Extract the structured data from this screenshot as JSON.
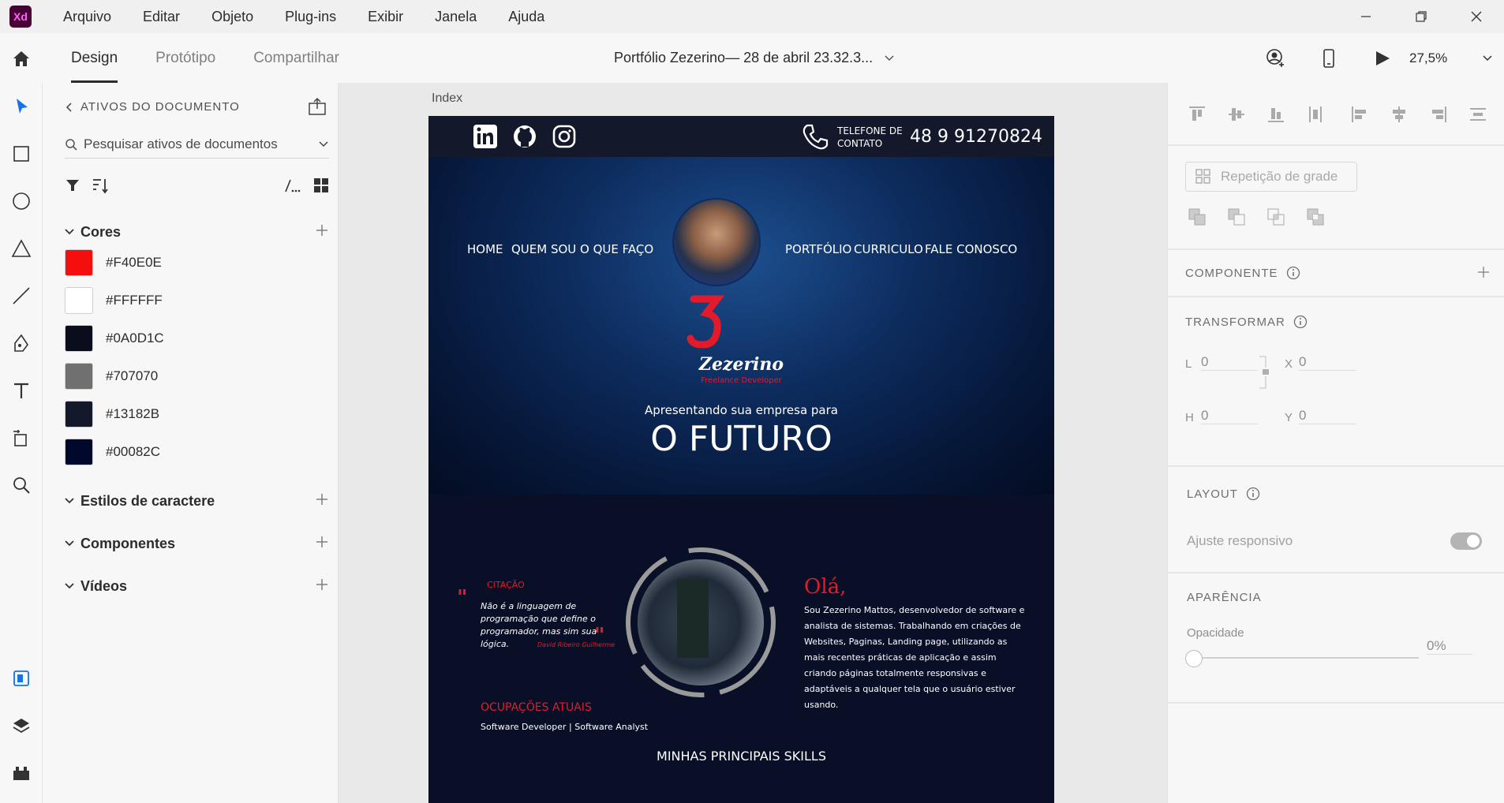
{
  "app": {
    "logo_text": "Xd",
    "menu": [
      "Arquivo",
      "Editar",
      "Objeto",
      "Plug-ins",
      "Exibir",
      "Janela",
      "Ajuda"
    ]
  },
  "header": {
    "tabs": [
      "Design",
      "Protótipo",
      "Compartilhar"
    ],
    "active_tab": "Design",
    "doc_title": "Portfólio Zezerino— 28 de abril 23.32.3...",
    "zoom": "27,5%"
  },
  "assets": {
    "title": "ATIVOS DO DOCUMENTO",
    "search_placeholder": "Pesquisar ativos de documentos",
    "sections": {
      "colors": "Cores",
      "char_styles": "Estilos de caractere",
      "components": "Componentes",
      "videos": "Vídeos"
    },
    "colors": [
      {
        "label": "#F40E0E",
        "hex": "#F40E0E"
      },
      {
        "label": "#FFFFFF",
        "hex": "#FFFFFF"
      },
      {
        "label": "#0A0D1C",
        "hex": "#0A0D1C"
      },
      {
        "label": "#707070",
        "hex": "#707070"
      },
      {
        "label": "#13182B",
        "hex": "#13182B"
      },
      {
        "label": "#00082C",
        "hex": "#00082C"
      }
    ]
  },
  "canvas": {
    "artboard_name": "Index",
    "artboard": {
      "phone_label_1": "TELEFONE DE",
      "phone_label_2": "CONTATO",
      "phone_number": "48 9 91270824",
      "nav_left": [
        "HOME",
        "QUEM SOU",
        "O QUE FAÇO"
      ],
      "nav_right": [
        "PORTFÓLIO",
        "CURRICULO",
        "FALE CONOSCO"
      ],
      "logo_name": "Zezerino",
      "logo_sub": "Freelance Developer",
      "intro_small": "Apresentando sua empresa para",
      "intro_big": "O FUTURO",
      "quote_label": "CITAÇÃO",
      "quote_text": "Não é a linguagem de programação que define o programador, mas sim sua lógica.",
      "quote_author": "David Ribeiro Guilherme",
      "hello": "Olá,",
      "about": "Sou Zezerino Mattos, desenvolvedor de software e analista de sistemas. Trabalhando  em criações de Websites, Paginas, Landing page, utilizando as mais recentes práticas de aplicação e assim criando páginas totalmente responsivas e adaptáveis a qualquer tela que o usuário estiver usando.",
      "occupations_title": "OCUPAÇÕES ATUAIS",
      "occupations": "Software Developer | Software Analyst",
      "skills_title": "MINHAS PRINCIPAIS SKILLS"
    }
  },
  "properties": {
    "grid_repeat": "Repetição de grade",
    "component": "COMPONENTE",
    "transform": "TRANSFORMAR",
    "w_label": "L",
    "w_value": "0",
    "h_label": "H",
    "h_value": "0",
    "x_label": "X",
    "x_value": "0",
    "y_label": "Y",
    "y_value": "0",
    "layout": "LAYOUT",
    "responsive": "Ajuste responsivo",
    "appearance": "APARÊNCIA",
    "opacity_label": "Opacidade",
    "opacity_value": "0%"
  }
}
